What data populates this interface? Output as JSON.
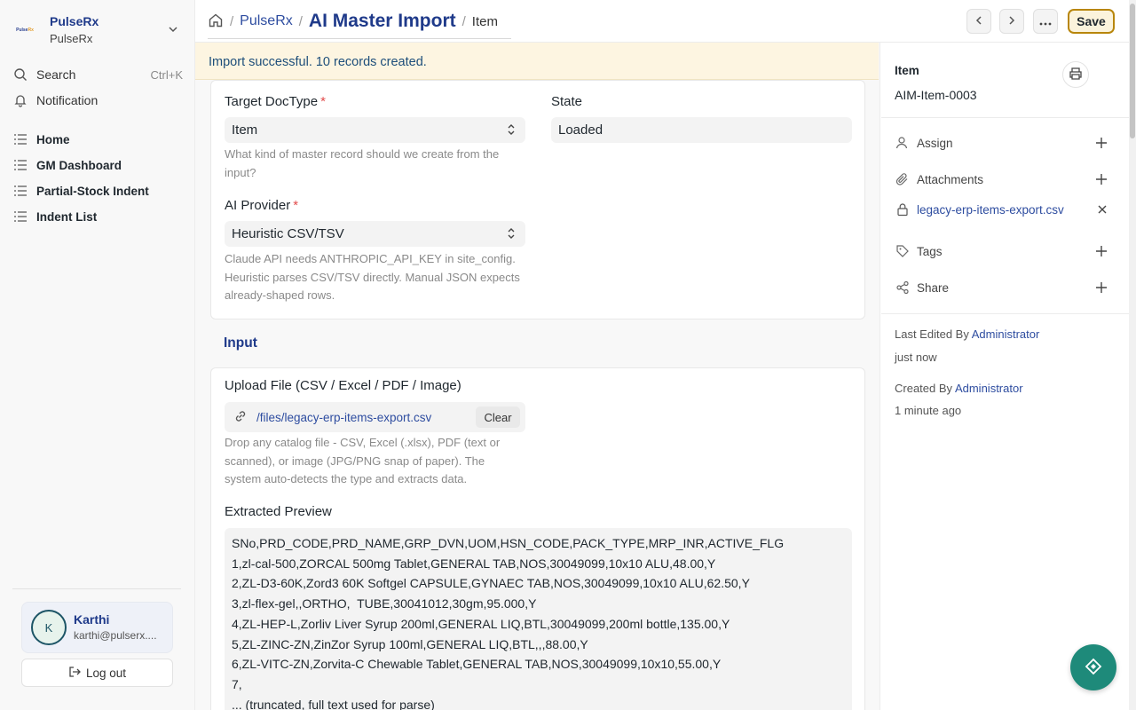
{
  "workspace": {
    "logo_a": "Pulse",
    "logo_b": "Rx",
    "title": "PulseRx",
    "subtitle": "PulseRx"
  },
  "sidebar": {
    "search_label": "Search",
    "search_shortcut": "Ctrl+K",
    "notification_label": "Notification",
    "items": [
      {
        "label": "Home"
      },
      {
        "label": "GM Dashboard"
      },
      {
        "label": "Partial-Stock Indent"
      },
      {
        "label": "Indent List"
      }
    ]
  },
  "user": {
    "initial": "K",
    "name": "Karthi",
    "email": "karthi@pulserx...."
  },
  "logout_label": "Log out",
  "breadcrumb": {
    "sep": "/",
    "root": "PulseRx",
    "title": "AI Master Import",
    "current": "Item"
  },
  "toolbar": {
    "save_label": "Save"
  },
  "alert": {
    "text": "Import successful. 10 records created."
  },
  "form": {
    "target_doctype": {
      "label": "Target DocType",
      "required_mark": "*",
      "value": "Item",
      "help": "What kind of master record should we create from the input?"
    },
    "state": {
      "label": "State",
      "value": "Loaded"
    },
    "ai_provider": {
      "label": "AI Provider",
      "required_mark": "*",
      "value": "Heuristic CSV/TSV",
      "help": "Claude API needs ANTHROPIC_API_KEY in site_config. Heuristic parses CSV/TSV directly. Manual JSON expects already-shaped rows."
    },
    "input_section_title": "Input",
    "upload": {
      "label": "Upload File (CSV / Excel / PDF / Image)",
      "file_path": "/files/legacy-erp-items-export.csv",
      "clear_label": "Clear",
      "help": "Drop any catalog file - CSV, Excel (.xlsx), PDF (text or scanned), or image (JPG/PNG snap of paper). The system auto-detects the type and extracts data."
    },
    "preview": {
      "label": "Extracted Preview",
      "text": "SNo,PRD_CODE,PRD_NAME,GRP_DVN,UOM,HSN_CODE,PACK_TYPE,MRP_INR,ACTIVE_FLG\n1,zl-cal-500,ZORCAL 500mg Tablet,GENERAL TAB,NOS,30049099,10x10 ALU,48.00,Y\n2,ZL-D3-60K,Zord3 60K Softgel CAPSULE,GYNAEC TAB,NOS,30049099,10x10 ALU,62.50,Y\n3,zl-flex-gel,,ORTHO,  TUBE,30041012,30gm,95.000,Y\n4,ZL-HEP-L,Zorliv Liver Syrup 200ml,GENERAL LIQ,BTL,30049099,200ml bottle,135.00,Y\n5,ZL-ZINC-ZN,ZinZor Syrup 100ml,GENERAL LIQ,BTL,,,88.00,Y\n6,ZL-VITC-ZN,Zorvita-C Chewable Tablet,GENERAL TAB,NOS,30049099,10x10,55.00,Y\n7,\n... (truncated, full text used for parse)"
    }
  },
  "right_panel": {
    "doctype": "Item",
    "doc_name": "AIM-Item-0003",
    "assign_label": "Assign",
    "attachments_label": "Attachments",
    "attachment_file": "legacy-erp-items-export.csv",
    "tags_label": "Tags",
    "share_label": "Share",
    "last_edited_prefix": "Last Edited By",
    "last_edited_by": "Administrator",
    "last_edited_time": "just now",
    "created_prefix": "Created By",
    "created_by": "Administrator",
    "created_time": "1 minute ago"
  },
  "colors": {
    "accent": "#1f3a8a",
    "save_border": "#b8860b",
    "alert_bg": "#fdf5e1",
    "fab": "#1e8a7a"
  }
}
